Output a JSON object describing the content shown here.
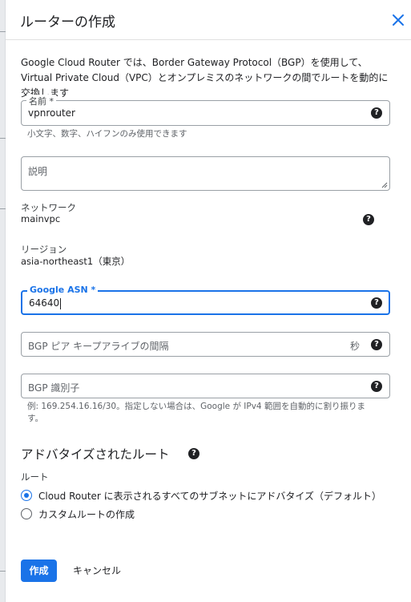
{
  "dialog": {
    "title": "ルーターの作成",
    "description": "Google Cloud Router では、Border Gateway Protocol（BGP）を使用して、Virtual Private Cloud（VPC）とオンプレミスのネットワークの間でルートを動的に交換します"
  },
  "name_field": {
    "label": "名前 *",
    "value": "vpnrouter",
    "hint": "小文字、数字、ハイフンのみ使用できます"
  },
  "description_field": {
    "placeholder": "説明"
  },
  "network": {
    "label": "ネットワーク",
    "value": "mainvpc"
  },
  "region": {
    "label": "リージョン",
    "value": "asia-northeast1（東京）"
  },
  "asn_field": {
    "label": "Google ASN *",
    "value": "64640"
  },
  "keepalive_field": {
    "placeholder": "BGP ピア キープアライブの間隔",
    "suffix": "秒"
  },
  "bgp_id_field": {
    "placeholder": "BGP 識別子",
    "hint": "例: 169.254.16.16/30。指定しない場合は、Google が IPv4 範囲を自動的に割り振ります。"
  },
  "advertised_routes": {
    "title": "アドバタイズされたルート",
    "group_label": "ルート",
    "options": [
      {
        "label": "Cloud Router に表示されるすべてのサブネットにアドバタイズ（デフォルト）",
        "checked": true
      },
      {
        "label": "カスタムルートの作成",
        "checked": false
      }
    ]
  },
  "actions": {
    "create_label": "作成",
    "cancel_label": "キャンセル"
  },
  "colors": {
    "accent": "#1a73e8",
    "text": "#202124",
    "muted": "#5f6368"
  },
  "icons": {
    "close": "close-icon",
    "help": "help-icon"
  }
}
